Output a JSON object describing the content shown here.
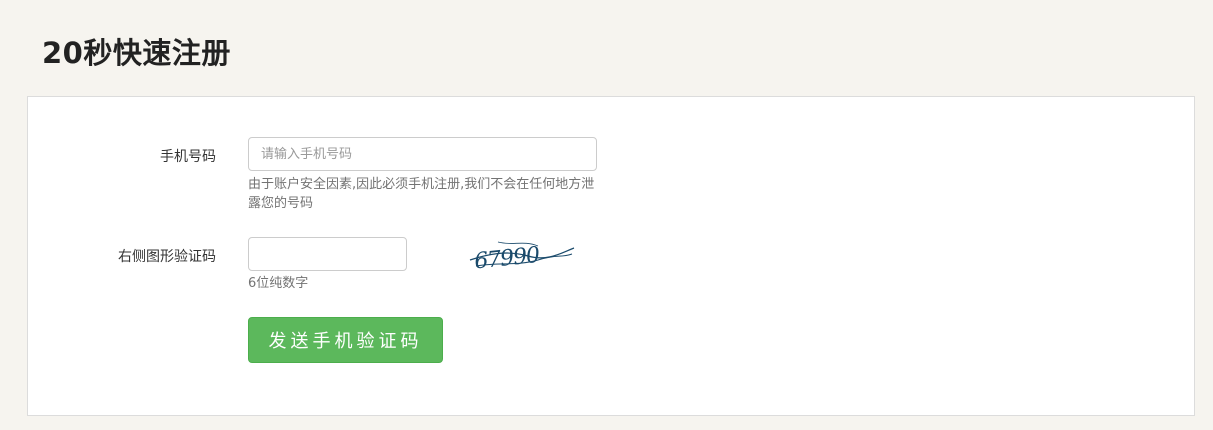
{
  "page": {
    "title": "20秒快速注册"
  },
  "form": {
    "phone": {
      "label": "手机号码",
      "placeholder": "请输入手机号码",
      "value": "",
      "help": "由于账户安全因素,因此必须手机注册,我们不会在任何地方泄露您的号码"
    },
    "captcha": {
      "label": "右侧图形验证码",
      "value": "",
      "help": "6位纯数字",
      "image_text": "67990",
      "image_color": "#1a4a6b"
    },
    "submit_label": "发送手机验证码"
  },
  "colors": {
    "accent_button": "#5cb85c",
    "background": "#f6f4ef"
  }
}
